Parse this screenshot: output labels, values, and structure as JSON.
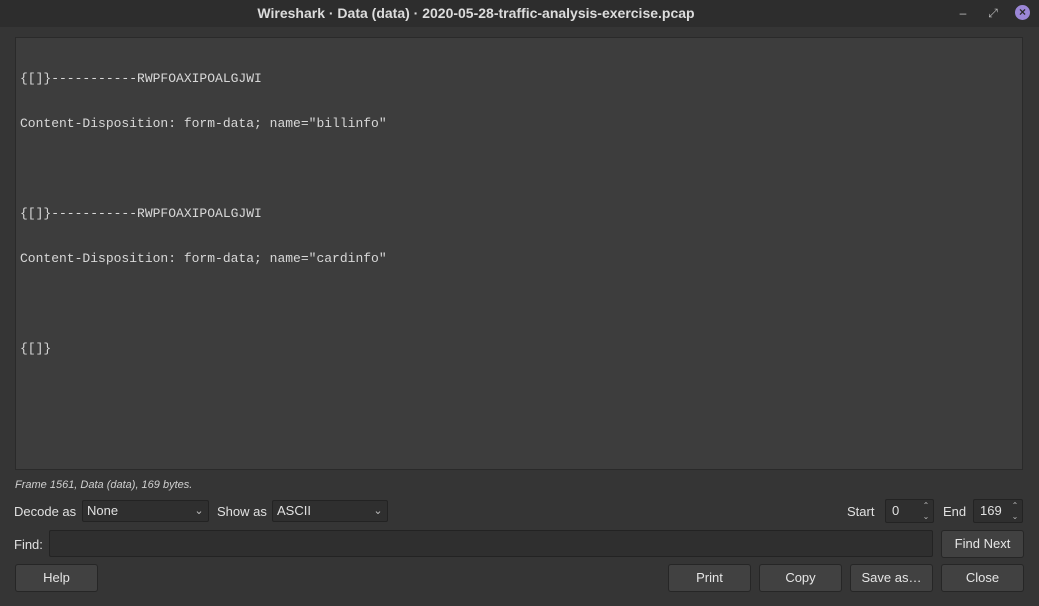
{
  "window": {
    "title": "Wireshark · Data (data) · 2020-05-28-traffic-analysis-exercise.pcap",
    "min_glyph": "–",
    "max_glyph": "⤢",
    "close_glyph": "×"
  },
  "content": {
    "lines": [
      "{[]}-----------RWPFOAXIPOALGJWI",
      "Content-Disposition: form-data; name=\"billinfo\"",
      "",
      "{[]}-----------RWPFOAXIPOALGJWI",
      "Content-Disposition: form-data; name=\"cardinfo\"",
      "",
      "{[]}"
    ]
  },
  "status": {
    "text": "Frame 1561, Data (data), 169 bytes."
  },
  "controls": {
    "decode_label": "Decode as",
    "decode_value": "None",
    "show_label": "Show as",
    "show_value": "ASCII",
    "start_label": "Start",
    "start_value": "0",
    "end_label": "End",
    "end_value": "169",
    "find_label": "Find:",
    "find_value": ""
  },
  "buttons": {
    "find_next": "Find Next",
    "help": "Help",
    "print": "Print",
    "copy": "Copy",
    "save_as": "Save as…",
    "close": "Close"
  }
}
